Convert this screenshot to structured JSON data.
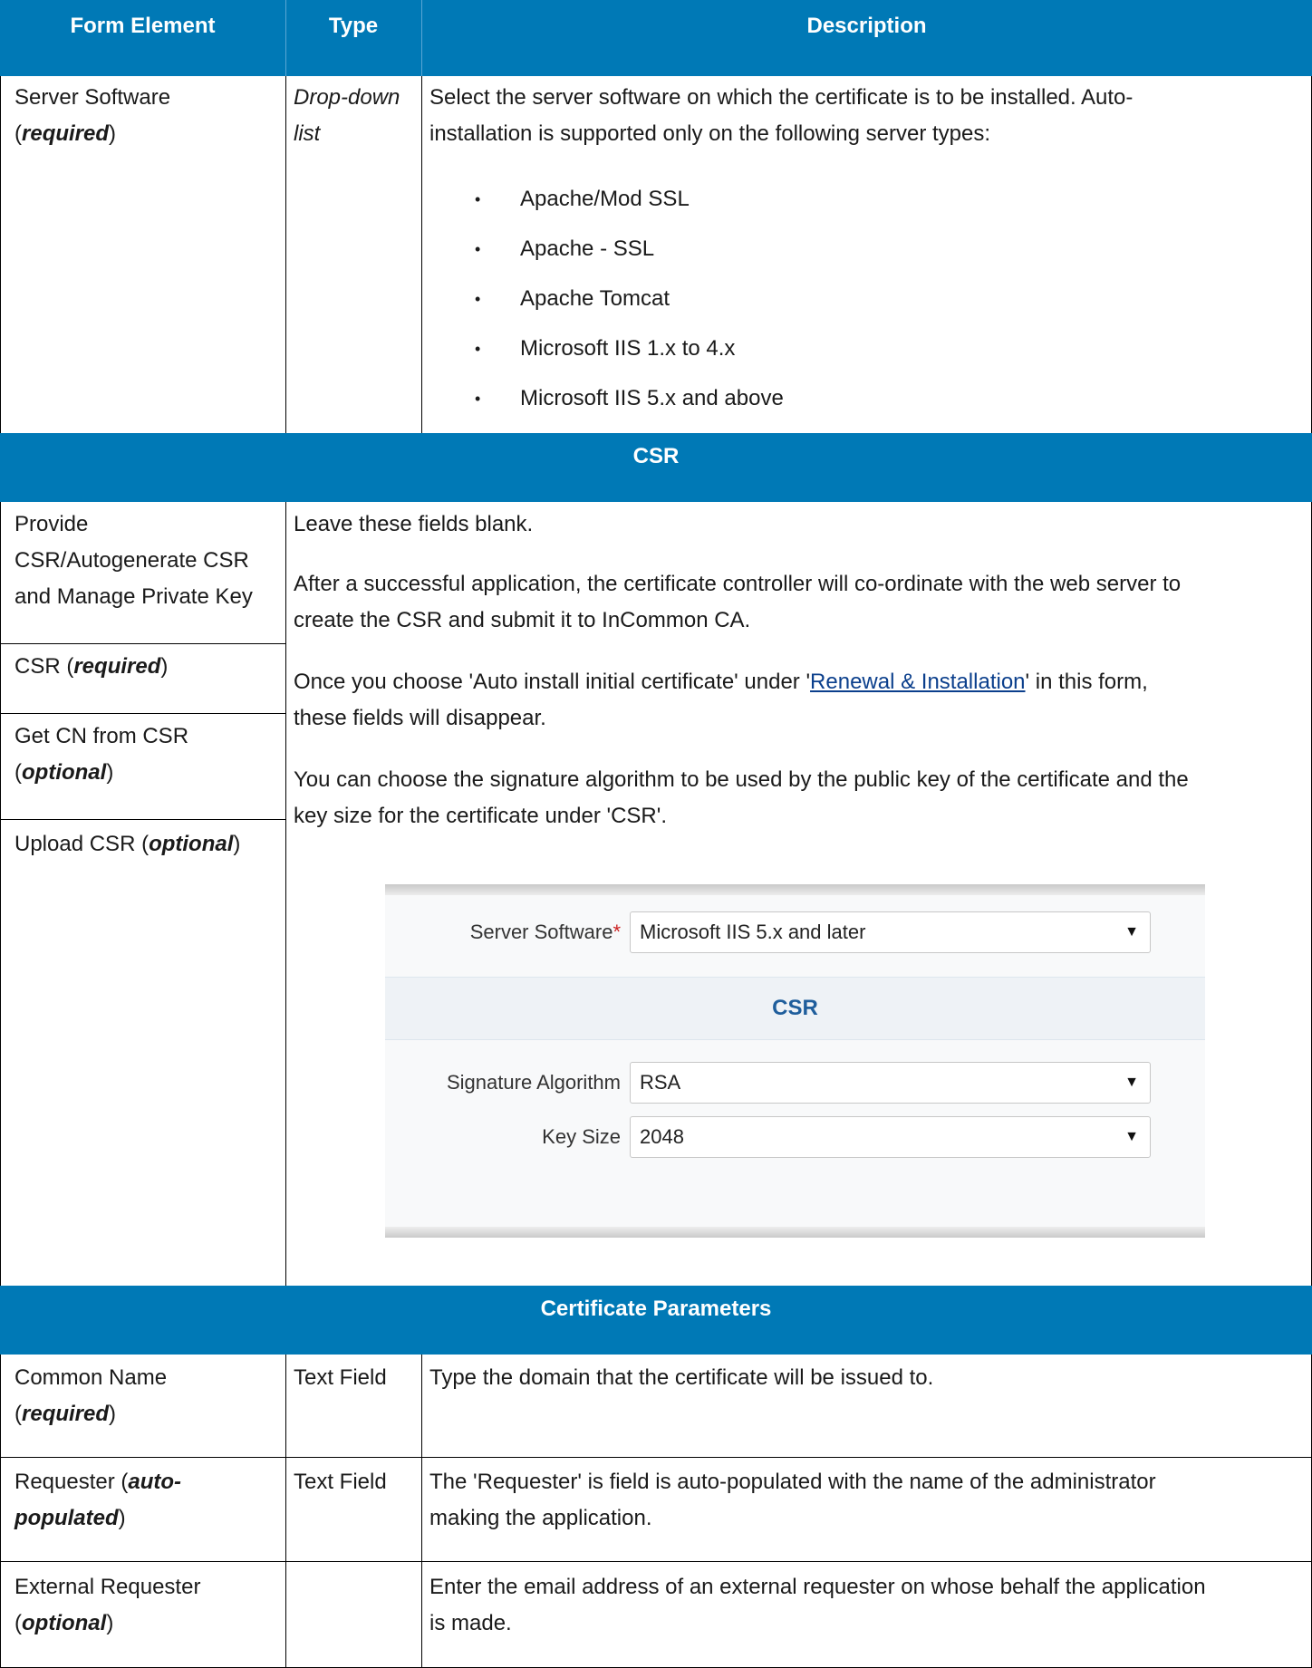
{
  "header": {
    "col1": "Form Element",
    "col2": "Type",
    "col3": "Description"
  },
  "server_row": {
    "name": "Server Software",
    "qualifier": "required",
    "type_line1": "Drop-down",
    "type_line2": "list",
    "desc_line1": "Select the server software on which the certificate is to be installed. Auto-",
    "desc_line2": "installation is supported only on the following server types:",
    "server_types": [
      "Apache/Mod SSL",
      "Apache - SSL",
      "Apache Tomcat",
      "Microsoft IIS 1.x to 4.x",
      "Microsoft IIS 5.x and above"
    ]
  },
  "csr_section": {
    "title": "CSR",
    "fields": {
      "provide_line1": "Provide",
      "provide_line2": "CSR/Autogenerate CSR",
      "provide_line3": "and Manage Private Key",
      "csr_name": "CSR",
      "csr_qualifier": "required",
      "getcn_name": "Get CN from CSR",
      "getcn_qualifier": "optional",
      "upload_name": "Upload CSR",
      "upload_qualifier": "optional"
    },
    "desc": {
      "p1": "Leave these fields blank.",
      "p2_line1": "After a successful application, the certificate controller will co-ordinate with the web server to",
      "p2_line2": "create the CSR and submit it to InCommon CA.",
      "p3_pre": "Once you choose 'Auto install initial certificate' under '",
      "p3_link": "Renewal & Installation",
      "p3_post": "' in this form,",
      "p3_line2": "these fields will disappear.",
      "p4_line1": "You can choose the signature algorithm to be used by the public key of the certificate and the",
      "p4_line2": "key size for the certificate under 'CSR'."
    },
    "screenshot": {
      "server_label": "Server Software",
      "server_required_mark": "*",
      "server_value": "Microsoft IIS 5.x and later",
      "csr_heading": "CSR",
      "sig_label": "Signature Algorithm",
      "sig_value": "RSA",
      "key_label": "Key Size",
      "key_value": "2048",
      "arrow_icon": "▼"
    }
  },
  "params_section": {
    "title": "Certificate Parameters",
    "rows": [
      {
        "name_line1": "Common Name",
        "qualifier": "required",
        "type": "Text Field",
        "desc_line1": "Type the domain that the certificate will be issued to.",
        "desc_line2": ""
      },
      {
        "name_line1": "Requester (",
        "qualifier_a": "auto-",
        "qualifier_b": "populated",
        "type": "Text Field",
        "desc_line1": "The 'Requester' is field is auto-populated with the name of the administrator",
        "desc_line2": "making the application."
      },
      {
        "name_line1": "External Requester",
        "qualifier": "optional",
        "type": "",
        "desc_line1": "Enter the email address of an external requester on whose behalf the application",
        "desc_line2": "is made."
      }
    ]
  },
  "colors": {
    "header_bg": "#0079b6",
    "header_text": "#ffffff",
    "link": "#0b3f8c",
    "required_star": "#cc2222"
  }
}
